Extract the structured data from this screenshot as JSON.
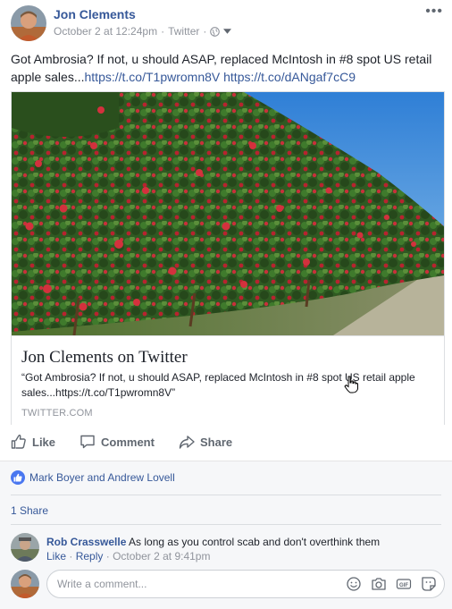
{
  "post": {
    "author": "Jon Clements",
    "date": "October 2 at 12:24pm",
    "source": "Twitter",
    "more_label": "•••",
    "text_plain": "Got Ambrosia? If not, u should ASAP, replaced McIntosh in #8 spot US retail apple sales...",
    "link1": "https://t.co/T1pwromn8V",
    "link2": "https://t.co/dANgaf7cC9"
  },
  "card": {
    "title": "Jon Clements on Twitter",
    "description": "“Got Ambrosia? If not, u should ASAP, replaced McIntosh in #8 spot US retail apple sales...https://t.co/T1pwromn8V”",
    "domain": "TWITTER.COM"
  },
  "actions": {
    "like": "Like",
    "comment": "Comment",
    "share": "Share"
  },
  "reactions": {
    "names": "Mark Boyer and Andrew Lovell"
  },
  "shares": "1 Share",
  "comment": {
    "author": "Rob Crasswelle",
    "text": "As long as you control scab and don't overthink them",
    "like": "Like",
    "reply": "Reply",
    "time": "October 2 at 9:41pm"
  },
  "composer": {
    "placeholder": "Write a comment..."
  },
  "colors": {
    "link": "#365899",
    "meta": "#90949c",
    "like_badge": "#4a77f0"
  },
  "icons": [
    "globe-icon",
    "chevron-down-icon",
    "like-icon",
    "comment-icon",
    "share-icon",
    "emoji-icon",
    "camera-icon",
    "gif-icon",
    "sticker-icon",
    "hand-cursor-icon"
  ]
}
